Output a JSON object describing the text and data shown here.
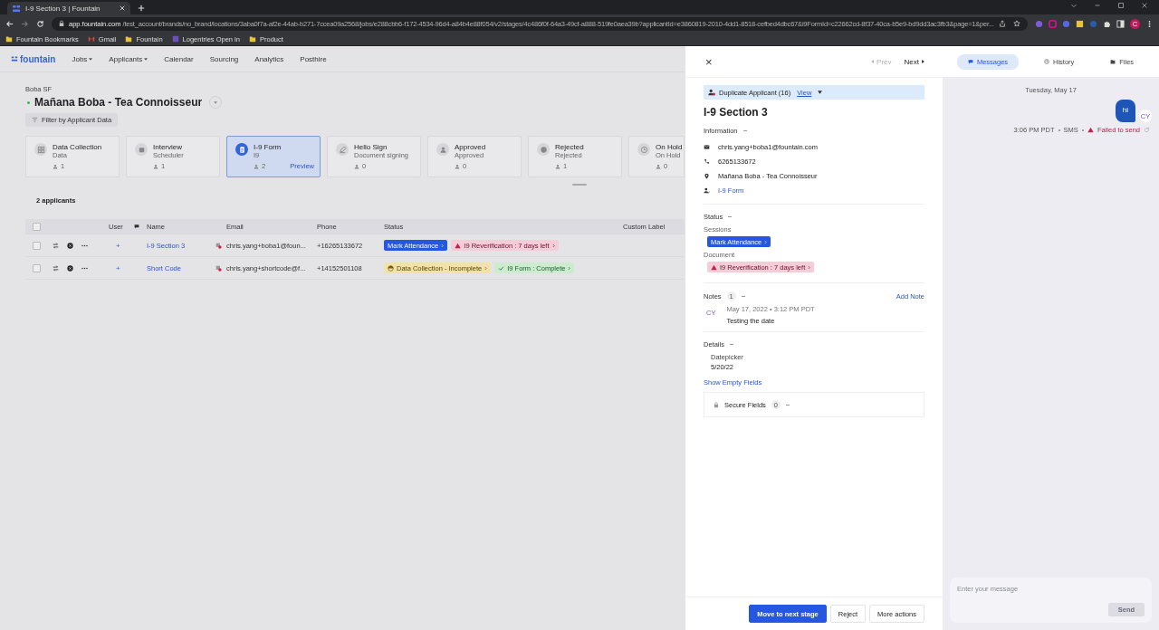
{
  "browser": {
    "tab_title": "I-9 Section 3 | Fountain",
    "url_host": "app.fountain.com",
    "url_path": "/test_account/brands/no_brand/locations/3aba0f7a-af2e-44ab-b271-7ccea09a2568/jobs/e288cbb6-f172-4534-96d4-a84b4e88f054/v2/stages/4c486f0f-64a3-49cf-a888-519fe0aea39b?applicantId=e3860819-2010-4dd1-8518-cefbed4dbc67&i9FormId=c22662cd-8f37-40ca-b5e9-bd9dd3ac3fb3&page=1&per...",
    "profile_initial": "C",
    "bookmarks": [
      {
        "label": "Fountain Bookmarks",
        "kind": "folder"
      },
      {
        "label": "Gmail",
        "kind": "gmail"
      },
      {
        "label": "Fountain",
        "kind": "folder"
      },
      {
        "label": "Logentries Open in",
        "kind": "app"
      },
      {
        "label": "Product",
        "kind": "folder"
      }
    ]
  },
  "nav": {
    "logo": "fountain",
    "items": [
      {
        "label": "Jobs",
        "dropdown": true
      },
      {
        "label": "Applicants",
        "dropdown": true
      },
      {
        "label": "Calendar",
        "dropdown": false
      },
      {
        "label": "Sourcing",
        "dropdown": false
      },
      {
        "label": "Analytics",
        "dropdown": false
      },
      {
        "label": "Posthire",
        "dropdown": false
      }
    ]
  },
  "job": {
    "breadcrumb": "Boba SF",
    "title": "Mañana Boba - Tea Connoisseur",
    "filter_button": "Filter by Applicant Data"
  },
  "stages": [
    {
      "name": "Data Collection",
      "subtitle": "Data",
      "count": "1",
      "selected": false
    },
    {
      "name": "Interview",
      "subtitle": "Scheduler",
      "count": "1",
      "selected": false
    },
    {
      "name": "I-9 Form",
      "subtitle": "I9",
      "count": "2",
      "selected": true,
      "link": "Preview"
    },
    {
      "name": "Hello Sign",
      "subtitle": "Document signing",
      "count": "0",
      "selected": false
    },
    {
      "name": "Approved",
      "subtitle": "Approved",
      "count": "0",
      "selected": false
    },
    {
      "name": "Rejected",
      "subtitle": "Rejected",
      "count": "1",
      "selected": false
    },
    {
      "name": "On Hold",
      "subtitle": "On Hold",
      "count": "0",
      "selected": false
    }
  ],
  "applicant_count": "2 applicants",
  "table": {
    "select_all": false,
    "columns": [
      "User",
      "Name",
      "Email",
      "Phone",
      "Status",
      "Custom Label"
    ],
    "rows": [
      {
        "checked": false,
        "user": "+",
        "name": "I-9 Section 3",
        "email": "chris.yang+boba1@foun...",
        "phone": "+16265133672",
        "tags": [
          {
            "kind": "action",
            "label": "Mark Attendance"
          },
          {
            "kind": "warning",
            "label": "I9 Reverification : 7 days left"
          }
        ]
      },
      {
        "checked": false,
        "user": "+",
        "name": "Short Code",
        "email": "chris.yang+shortcode@f...",
        "phone": "+14152501108",
        "tags": [
          {
            "kind": "pending",
            "label": "Data Collection - Incomplete"
          },
          {
            "kind": "complete",
            "label": "I9 Form : Complete"
          }
        ]
      }
    ]
  },
  "panel": {
    "close": "×",
    "prev": "Prev",
    "prev_disabled": true,
    "next": "Next",
    "duplicate": {
      "label": "Duplicate Applicant (16)",
      "link": "View"
    },
    "title": "I-9 Section 3",
    "information": {
      "heading": "Information",
      "items": [
        {
          "kind": "email",
          "text": "chris.yang+boba1@fountain.com"
        },
        {
          "kind": "phone",
          "text": "6265133672"
        },
        {
          "kind": "location",
          "text": "Mañana Boba - Tea Connoisseur"
        },
        {
          "kind": "stage",
          "text": "I-9 Form"
        }
      ]
    },
    "status": {
      "heading": "Status",
      "groups": [
        {
          "label": "Sessions",
          "tag": {
            "kind": "action",
            "label": "Mark Attendance"
          }
        },
        {
          "label": "Document",
          "tag": {
            "kind": "warning",
            "label": "I9 Reverification : 7 days left"
          }
        }
      ]
    },
    "notes": {
      "heading": "Notes",
      "count": "1",
      "add": "Add Note",
      "items": [
        {
          "initials": "CY",
          "date": "May 17, 2022 • 3:12 PM PDT",
          "text": "Testing the date"
        }
      ]
    },
    "details": {
      "heading": "Details",
      "fields": [
        {
          "label": "Datepicker",
          "value": "5/20/22"
        }
      ],
      "show_empty": "Show Empty Fields"
    },
    "secure": {
      "label": "Secure Fields",
      "count": "0"
    },
    "actions": [
      {
        "kind": "primary",
        "label": "Move to next stage"
      },
      {
        "kind": "secondary",
        "label": "Reject"
      },
      {
        "kind": "secondary",
        "label": "More actions"
      }
    ]
  },
  "messages": {
    "tabs": [
      {
        "label": "Messages",
        "selected": true
      },
      {
        "label": "History",
        "selected": false
      },
      {
        "label": "Files",
        "selected": false
      }
    ],
    "date": "Tuesday, May 17",
    "items": [
      {
        "text": "hi",
        "initials": "CY",
        "time": "3:06 PM PDT",
        "channel": "SMS",
        "failed": true,
        "error": "Failed to send"
      }
    ],
    "input": {
      "placeholder": "Enter your message"
    },
    "send": {
      "label": "Send",
      "disabled": true
    }
  }
}
